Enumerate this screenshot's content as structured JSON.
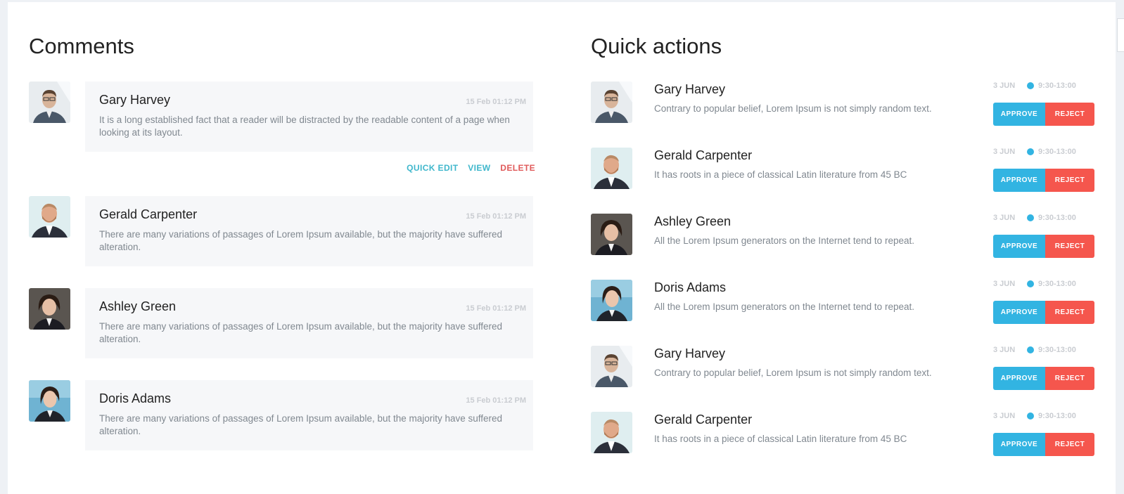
{
  "comments_section": {
    "title": "Comments",
    "items": [
      {
        "name": "Gary Harvey",
        "date": "15 Feb 01:12 PM",
        "text": "It is a long established fact that a reader will be distracted by the readable content of a page when looking at its layout.",
        "avatar": "man-glasses"
      },
      {
        "name": "Gerald Carpenter",
        "date": "15 Feb 01:12 PM",
        "text": "There are many variations of passages of Lorem Ipsum available, but the majority have suffered alteration.",
        "avatar": "man-beard"
      },
      {
        "name": "Ashley Green",
        "date": "15 Feb 01:12 PM",
        "text": "There are many variations of passages of Lorem Ipsum available, but the majority have suffered alteration.",
        "avatar": "woman-dark"
      },
      {
        "name": "Doris Adams",
        "date": "15 Feb 01:12 PM",
        "text": "There are many variations of passages of Lorem Ipsum available, but the majority have suffered alteration.",
        "avatar": "woman-blue"
      }
    ],
    "actions": {
      "quick_edit": "QUICK EDIT",
      "view": "VIEW",
      "delete": "DELETE"
    }
  },
  "quick_actions": {
    "title": "Quick actions",
    "approve_label": "APPROVE",
    "reject_label": "REJECT",
    "items": [
      {
        "name": "Gary Harvey",
        "text": "Contrary to popular belief, Lorem Ipsum is not simply random text.",
        "date": "3 JUN",
        "time": "9:30-13:00",
        "avatar": "man-glasses"
      },
      {
        "name": "Gerald Carpenter",
        "text": "It has roots in a piece of classical Latin literature from 45 BC",
        "date": "3 JUN",
        "time": "9:30-13:00",
        "avatar": "man-beard"
      },
      {
        "name": "Ashley Green",
        "text": "All the Lorem Ipsum generators on the Internet tend to repeat.",
        "date": "3 JUN",
        "time": "9:30-13:00",
        "avatar": "woman-dark"
      },
      {
        "name": "Doris Adams",
        "text": "All the Lorem Ipsum generators on the Internet tend to repeat.",
        "date": "3 JUN",
        "time": "9:30-13:00",
        "avatar": "woman-blue"
      },
      {
        "name": "Gary Harvey",
        "text": "Contrary to popular belief, Lorem Ipsum is not simply random text.",
        "date": "3 JUN",
        "time": "9:30-13:00",
        "avatar": "man-glasses"
      },
      {
        "name": "Gerald Carpenter",
        "text": "It has roots in a piece of classical Latin literature from 45 BC",
        "date": "3 JUN",
        "time": "9:30-13:00",
        "avatar": "man-beard"
      }
    ]
  },
  "colors": {
    "approve": "#32b4e2",
    "reject": "#f5564d",
    "action_link": "#3fb7cc",
    "delete_link": "#e05a5a"
  }
}
